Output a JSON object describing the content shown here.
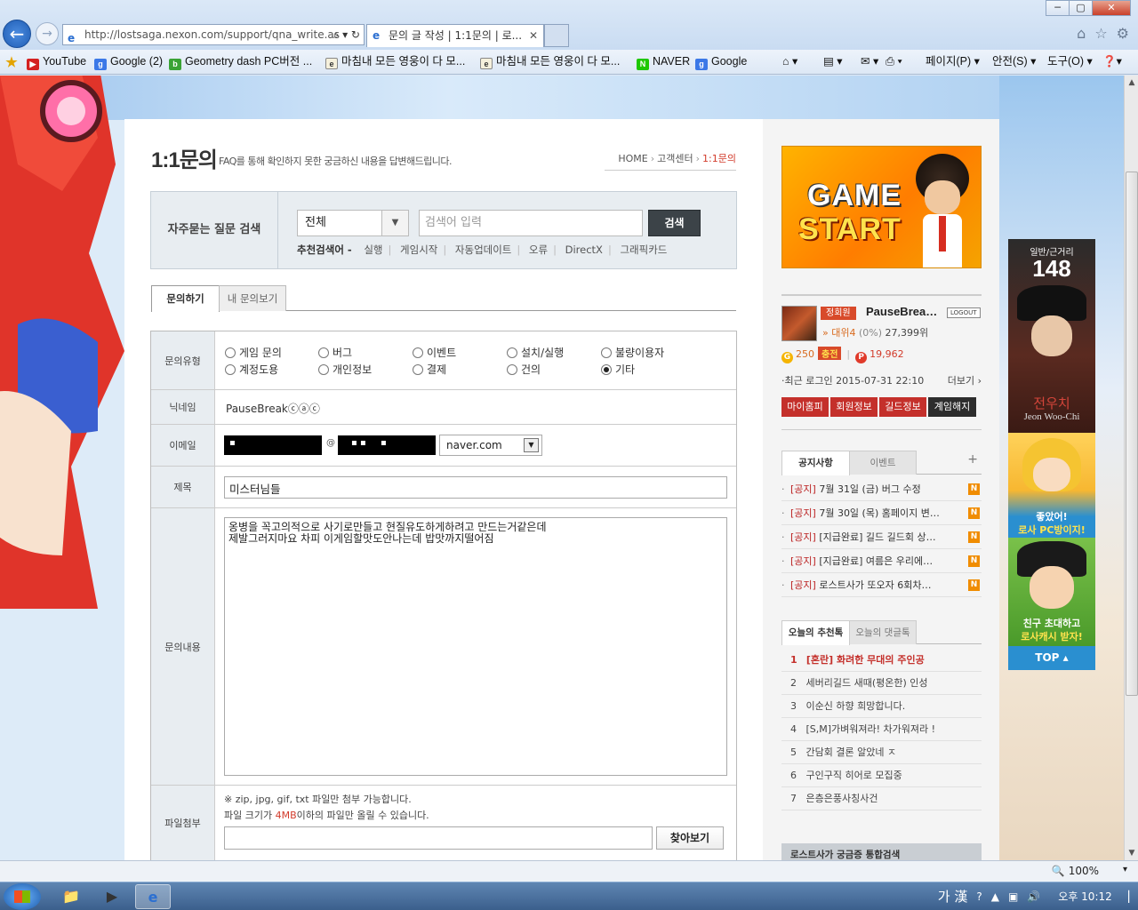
{
  "browser": {
    "address": "http://lostsaga.nexon.com/support/qna_write.as",
    "address_domain": "lostsaga.nexon.com",
    "tab_title": "문의 글 작성 | 1:1문의 | 로...",
    "win_min": "─",
    "win_max": "▢",
    "win_close": "✕",
    "favorites": [
      {
        "label": "YouTube",
        "icon": "youtube-icon"
      },
      {
        "label": "Google (2)",
        "icon": "google-icon"
      },
      {
        "label": "Geometry dash PC버전 ...",
        "icon": "blog-icon"
      },
      {
        "label": "마침내 모든 영웅이 다 모...",
        "icon": "page-icon"
      },
      {
        "label": "마침내 모든 영웅이 다 모...",
        "icon": "page-icon"
      },
      {
        "label": "NAVER",
        "icon": "naver-icon"
      },
      {
        "label": "Google",
        "icon": "google-icon"
      }
    ],
    "commands": {
      "page": "페이지(P)",
      "safety": "안전(S)",
      "tools": "도구(O)"
    },
    "zoom": "100%"
  },
  "page": {
    "title": "1:1문의",
    "description": "FAQ를 통해 확인하지 못한 궁금하신 내용을 답변해드립니다.",
    "breadcrumb": [
      "HOME",
      "고객센터",
      "1:1문의"
    ]
  },
  "faq_search": {
    "label": "자주묻는 질문 검색",
    "category": "전체",
    "placeholder": "검색어 입력",
    "button": "검색",
    "recommended_label": "추천검색어 -",
    "keywords": [
      "실행",
      "게임시작",
      "자동업데이트",
      "오류",
      "DirectX",
      "그래픽카드"
    ]
  },
  "tabs": [
    "문의하기",
    "내 문의보기"
  ],
  "form": {
    "type_label": "문의유형",
    "types": [
      {
        "label": "게임 문의",
        "checked": false
      },
      {
        "label": "버그",
        "checked": false
      },
      {
        "label": "이벤트",
        "checked": false
      },
      {
        "label": "설치/실행",
        "checked": false
      },
      {
        "label": "불량이용자",
        "checked": false
      },
      {
        "label": "계정도용",
        "checked": false
      },
      {
        "label": "개인정보",
        "checked": false
      },
      {
        "label": "결제",
        "checked": false
      },
      {
        "label": "건의",
        "checked": false
      },
      {
        "label": "기타",
        "checked": true
      }
    ],
    "nickname_label": "닉네임",
    "nickname": "PauseBreakⓒⓐⓒ",
    "email_label": "이메일",
    "email_at": "@",
    "email_domain": "naver.com",
    "subject_label": "제목",
    "subject": "미스터님들",
    "content_label": "문의내용",
    "content_line1": "옹병을 꼭고의적으로 사기로만들고 현질유도하게하려고 만드는거같은데",
    "content_line2": "제발그러지마요 차피 이게임할맛도안나는데 밥맛까지떨어짐",
    "attach_label": "파일첨부",
    "attach_note1": "※ zip, jpg, gif, txt 파일만 첨부 가능합니다.",
    "attach_note2_pre": "파일 크기가 ",
    "attach_note2_size": "4MB",
    "attach_note2_post": "이하의 파일만 올릴 수 있습니다.",
    "browse_button": "찾아보기"
  },
  "sidebar": {
    "banner_line1": "GAME",
    "banner_line2": "START",
    "user": {
      "grade": "정회원",
      "name": "PauseBrea…",
      "logout": "LOGOUT",
      "rank": "대위4",
      "rank_pct": "(0%)",
      "exp": "27,399위",
      "gold": "250",
      "charge": "충전",
      "points": "19,962",
      "last_login": "·최근 로그인 2015-07-31 22:10",
      "more": "더보기 ›",
      "buttons": [
        "마이홈피",
        "회원정보",
        "길드정보",
        "계임해지"
      ]
    },
    "notice_tabs": [
      "공지사항",
      "이벤트"
    ],
    "notice_plus": "+",
    "notices": [
      {
        "tag": "[공지]",
        "text": " 7월 31일 (금) 버그 수정"
      },
      {
        "tag": "[공지]",
        "text": " 7월 30일 (목) 홈페이지 변…"
      },
      {
        "tag": "[공지]",
        "text": " [지급완료] 길드 길드회 상…"
      },
      {
        "tag": "[공지]",
        "text": " [지급완료] 여름은 우리에…"
      },
      {
        "tag": "[공지]",
        "text": " 로스트사가 또오자 6회차…"
      }
    ],
    "new_badge": "N",
    "rank_tabs": [
      "오늘의 추천톡",
      "오늘의 댓글톡"
    ],
    "recommended": [
      {
        "num": "1",
        "text": "[혼란] 화려한 무대의 주인공"
      },
      {
        "num": "2",
        "text": "세버리길드 새때(평온한) 인성"
      },
      {
        "num": "3",
        "text": "이순신 하향 희망합니다."
      },
      {
        "num": "4",
        "text": "[S,M]가벼워져라! 차가워져라 !"
      },
      {
        "num": "5",
        "text": "간담회 결론 알았네 ㅈ"
      },
      {
        "num": "6",
        "text": "구인구직 히어로 모집중"
      },
      {
        "num": "7",
        "text": "은층은풍사칭사건"
      }
    ],
    "unified_search": "로스트사가 궁금증 통합검색"
  },
  "float_banner": {
    "distance": "일반/근거리",
    "hero_no": "148",
    "hero_kr": "전우치",
    "hero_en": "Jeon Woo-Chi",
    "promo1_a": "좋았어!",
    "promo1_b": "로사 PC방이지!",
    "promo2_a": "친구 초대하고",
    "promo2_b": "로사캐시 받자!",
    "top": "TOP ▴"
  },
  "taskbar": {
    "ime": "가 漢",
    "time": "오후 10:12"
  }
}
